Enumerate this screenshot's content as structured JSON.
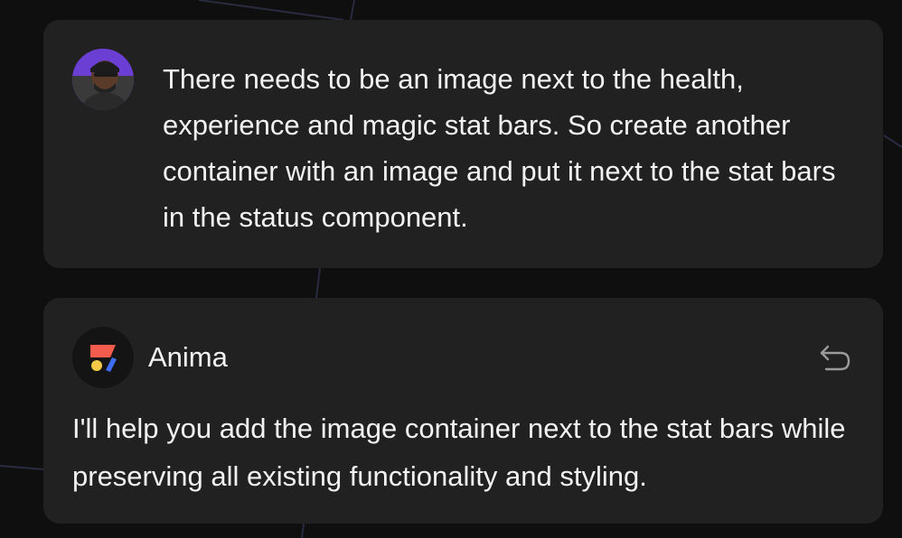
{
  "user_message": {
    "avatar_icon": "user-avatar",
    "text": "There needs to be an image next to the health, experience and magic stat bars. So create another container with an image and put it next to the stat bars in the status component."
  },
  "assistant_message": {
    "logo_icon": "anima-logo-icon",
    "name": "Anima",
    "undo_icon": "undo-icon",
    "text": "I'll help you add the image container next to the stat bars while preserving all existing functionality and styling."
  },
  "colors": {
    "background": "#0f0f10",
    "card": "#212121",
    "text": "#f2f2f2",
    "avatar_bg": "#6b3fd4",
    "logo_red": "#f25c4c",
    "logo_blue": "#3d6ef5",
    "logo_yellow": "#f7c948"
  }
}
